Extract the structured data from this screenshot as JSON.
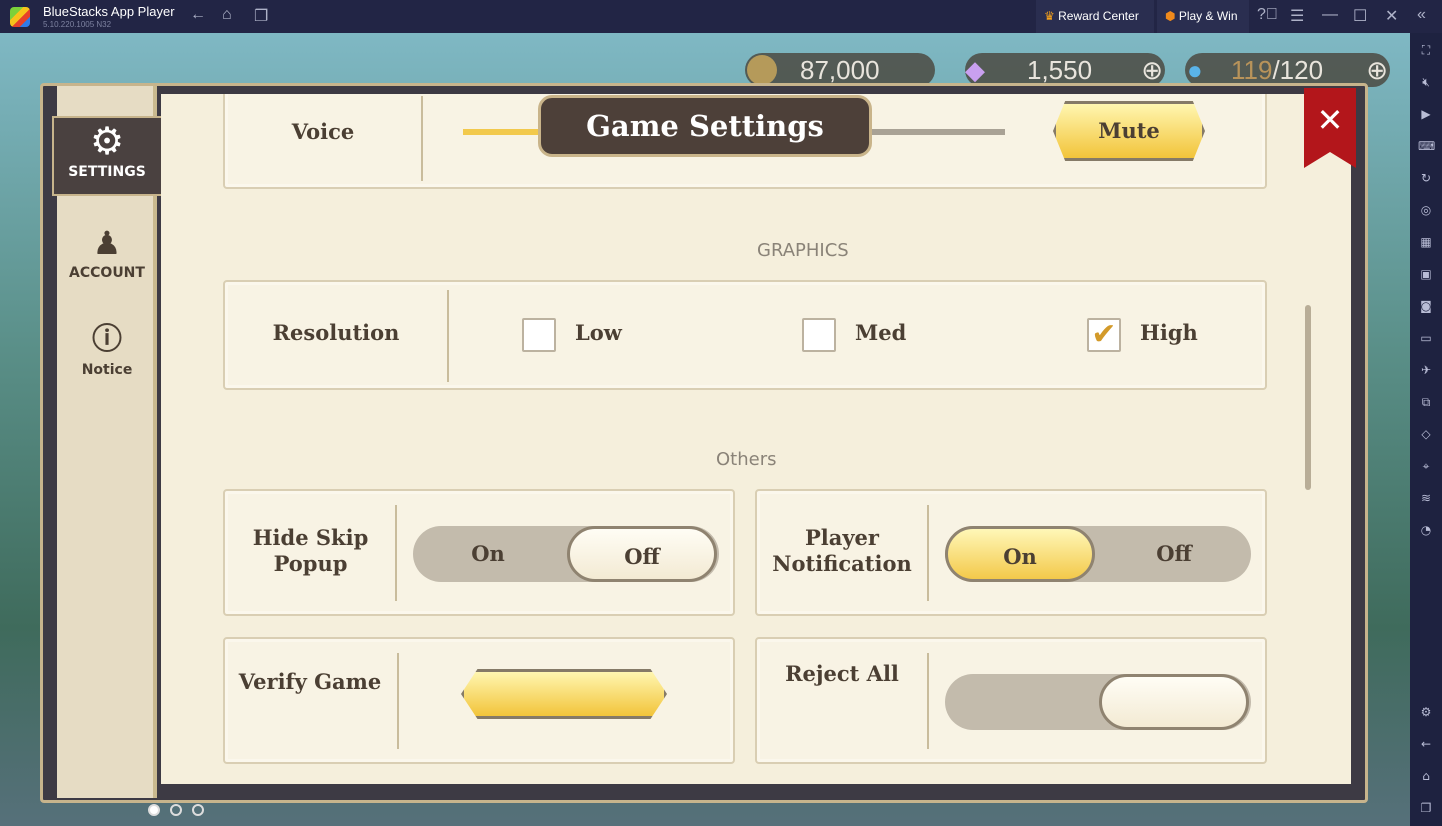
{
  "titlebar": {
    "app_name": "BlueStacks App Player",
    "version": "5.10.220.1005  N32",
    "reward_center": "Reward Center",
    "play_win": "Play & Win"
  },
  "resources": {
    "gold": "87,000",
    "gems": "1,550",
    "stamina_current": "119",
    "stamina_max": "/120"
  },
  "panel": {
    "title": "Game Settings",
    "close": "✕"
  },
  "tabs": [
    {
      "label": "SETTINGS",
      "icon": "gear-icon"
    },
    {
      "label": "ACCOUNT",
      "icon": "person-icon"
    },
    {
      "label": "Notice",
      "icon": "exclamation-icon"
    }
  ],
  "voice": {
    "label": "Voice",
    "level": 0.55,
    "mute_label": "Mute"
  },
  "graphics": {
    "heading": "GRAPHICS",
    "resolution_label": "Resolution",
    "options": [
      "Low",
      "Med",
      "High"
    ],
    "selected": "High"
  },
  "others": {
    "heading": "Others",
    "hide_skip": {
      "label": "Hide Skip Popup",
      "on": "On",
      "off": "Off",
      "value": "Off"
    },
    "player_notification": {
      "label": "Player Notification",
      "on": "On",
      "off": "Off",
      "value": "On"
    },
    "verify_game": {
      "label": "Verify Game"
    },
    "reject_all": {
      "label": "Reject All"
    }
  },
  "colors": {
    "titlebar": "#222545",
    "slider_fill": "#f2c94c",
    "close_ribbon": "#b3161b"
  }
}
